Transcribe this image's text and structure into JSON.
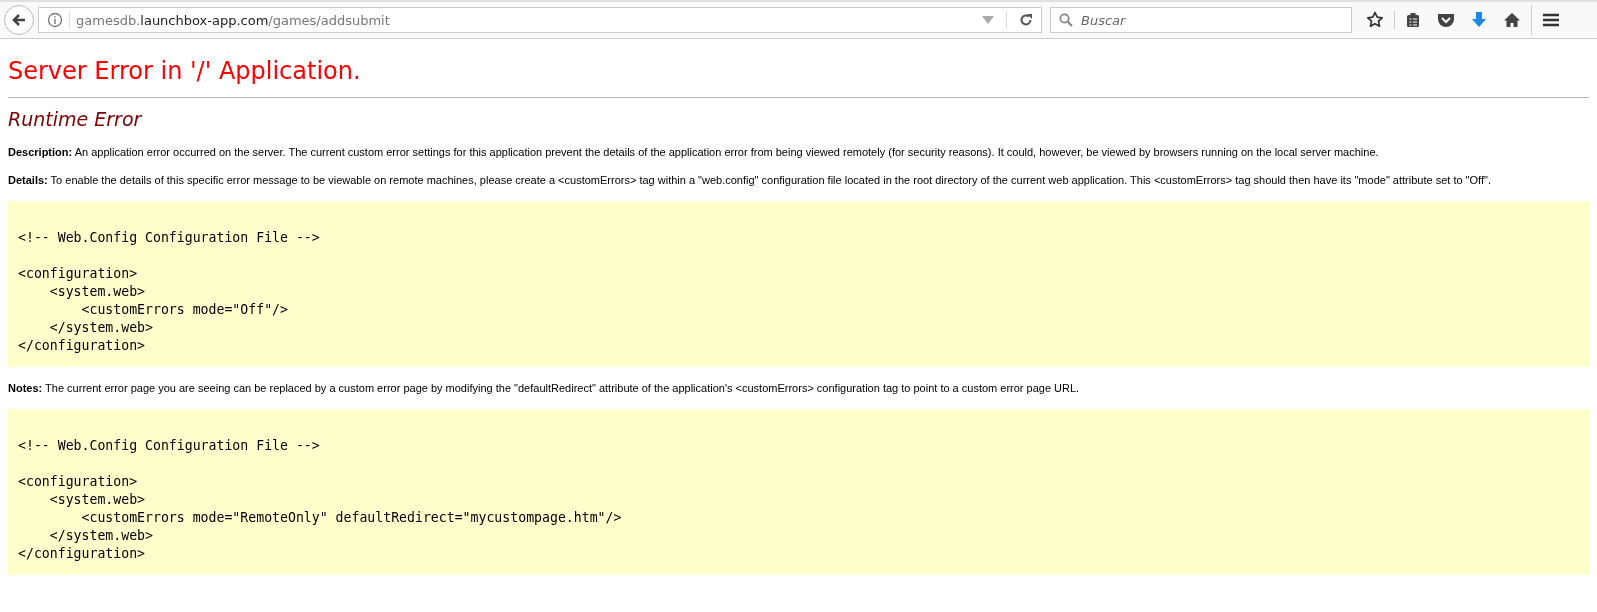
{
  "browser": {
    "url_prefix": "gamesdb.",
    "url_domain": "launchbox-app.com",
    "url_path": "/games/addsubmit",
    "search": {
      "placeholder": "Buscar"
    }
  },
  "page": {
    "title": "Server Error in '/' Application.",
    "subtitle": "Runtime Error",
    "sections": [
      {
        "kind": "text",
        "label": "Description:",
        "text": "An application error occurred on the server. The current custom error settings for this application prevent the details of the application error from being viewed remotely (for security reasons). It could, however, be viewed by browsers running on the local server machine."
      },
      {
        "kind": "text",
        "label": "Details:",
        "text": "To enable the details of this specific error message to be viewable on remote machines, please create a <customErrors> tag within a \"web.config\" configuration file located in the root directory of the current web application. This <customErrors> tag should then have its \"mode\" attribute set to \"Off\"."
      },
      {
        "kind": "code",
        "comment": "<!-- Web.Config Configuration File -->",
        "lines": [
          "<configuration>",
          "    <system.web>",
          "        <customErrors mode=\"Off\"/>",
          "    </system.web>",
          "</configuration>"
        ]
      },
      {
        "kind": "text",
        "label": "Notes:",
        "text": "The current error page you are seeing can be replaced by a custom error page by modifying the \"defaultRedirect\" attribute of the application's <customErrors> configuration tag to point to a custom error page URL."
      },
      {
        "kind": "code",
        "comment": "<!-- Web.Config Configuration File -->",
        "lines": [
          "<configuration>",
          "    <system.web>",
          "        <customErrors mode=\"RemoteOnly\" defaultRedirect=\"mycustompage.htm\"/>",
          "    </system.web>",
          "</configuration>"
        ]
      }
    ]
  }
}
